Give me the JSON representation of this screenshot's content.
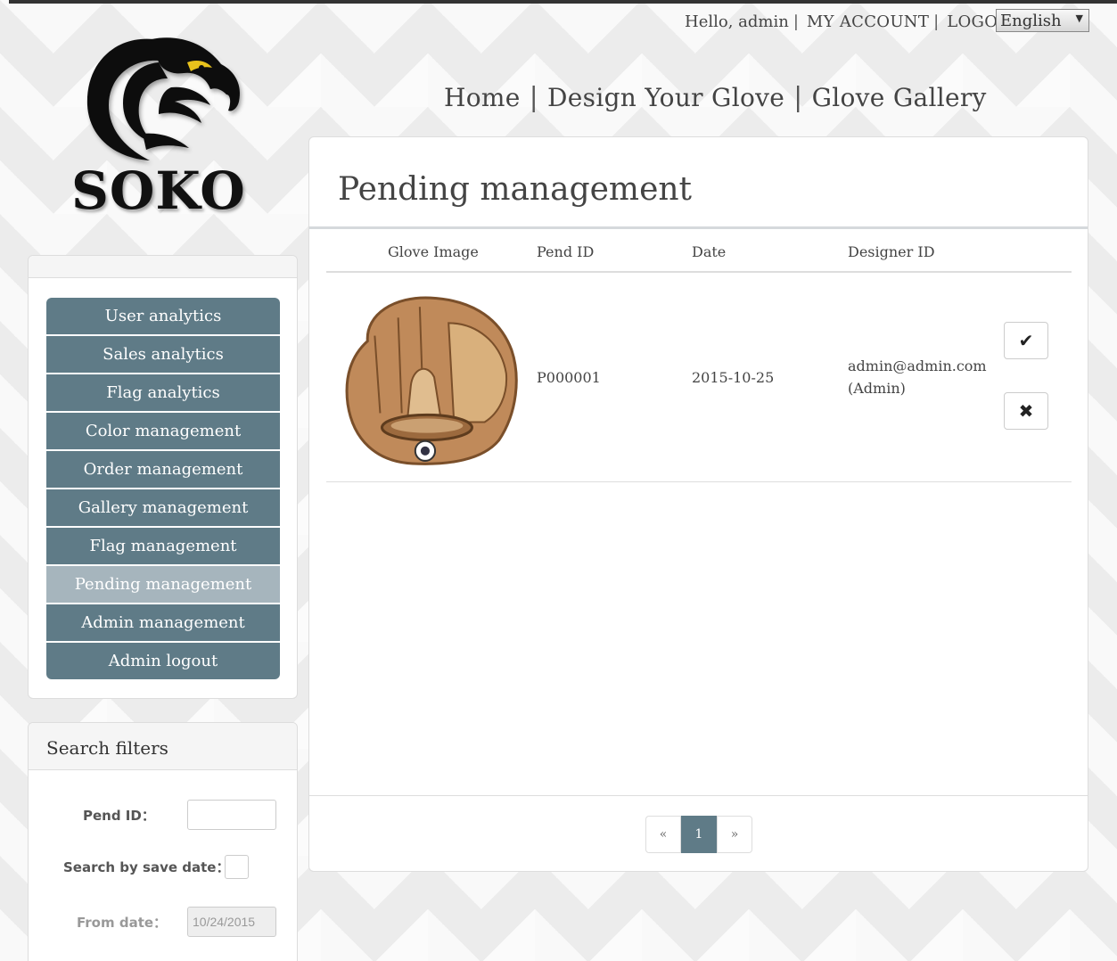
{
  "header": {
    "greeting": "Hello, admin",
    "my_account": "MY ACCOUNT",
    "logout": "LOGOUT",
    "separator": "|",
    "language": "English"
  },
  "logo": {
    "brand": "SOKO"
  },
  "main_nav": {
    "items": [
      "Home",
      "Design Your Glove",
      "Glove Gallery"
    ],
    "separator": "|"
  },
  "sidebar": {
    "items": [
      {
        "label": "User analytics"
      },
      {
        "label": "Sales analytics"
      },
      {
        "label": "Flag analytics"
      },
      {
        "label": "Color management"
      },
      {
        "label": "Order management"
      },
      {
        "label": "Gallery management"
      },
      {
        "label": "Flag management"
      },
      {
        "label": "Pending management",
        "active": true
      },
      {
        "label": "Admin management"
      },
      {
        "label": "Admin logout"
      }
    ]
  },
  "filters": {
    "title": "Search filters",
    "pend_id_label": "Pend ID：",
    "pend_id_value": "",
    "save_date_label": "Search by save date：",
    "from_date_label": "From date：",
    "from_date_value": "10/24/2015"
  },
  "content": {
    "title": "Pending management",
    "columns": [
      "Glove Image",
      "Pend ID",
      "Date",
      "Designer ID"
    ],
    "rows": [
      {
        "pend_id": "P000001",
        "date": "2015-10-25",
        "designer_email": "admin@admin.com",
        "designer_role": "(Admin)",
        "approve_icon": "check-icon",
        "reject_icon": "close-icon"
      }
    ]
  },
  "pagination": {
    "prev": "«",
    "current": "1",
    "next": "»"
  },
  "colors": {
    "menu": "#5f7b87",
    "menu_active": "#a6b5bd",
    "glove": "#c08a5a"
  }
}
